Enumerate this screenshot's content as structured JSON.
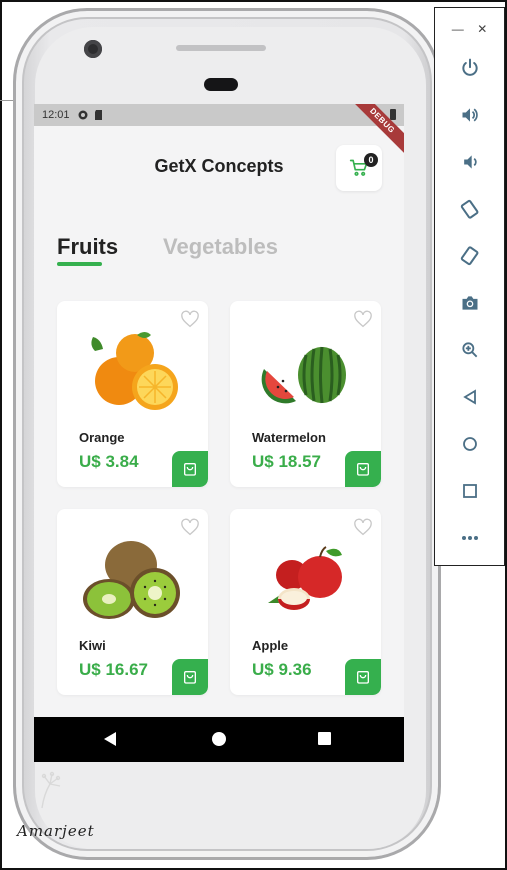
{
  "status_bar": {
    "time": "12:01",
    "debug_label": "DEBUG"
  },
  "app": {
    "title": "GetX Concepts",
    "cart_count": "0"
  },
  "tabs": [
    {
      "label": "Fruits",
      "active": true
    },
    {
      "label": "Vegetables",
      "active": false
    }
  ],
  "products": [
    {
      "name": "Orange",
      "price": "U$ 3.84",
      "image": "orange-image"
    },
    {
      "name": "Watermelon",
      "price": "U$ 18.57",
      "image": "watermelon-image"
    },
    {
      "name": "Kiwi",
      "price": "U$ 16.67",
      "image": "kiwi-image"
    },
    {
      "name": "Apple",
      "price": "U$ 9.36",
      "image": "apple-image"
    }
  ],
  "colors": {
    "accent": "#35b04e",
    "price": "#3aad4a",
    "inactive_tab": "#bdbdbd"
  },
  "emulator_toolbar": [
    "minimize-icon",
    "close-icon",
    "power-icon",
    "volume-up-icon",
    "volume-down-icon",
    "rotate-left-icon",
    "rotate-right-icon",
    "camera-icon",
    "zoom-icon",
    "back-icon",
    "home-icon",
    "overview-icon",
    "more-icon"
  ],
  "watermark": {
    "signature": "Amarjeet"
  }
}
